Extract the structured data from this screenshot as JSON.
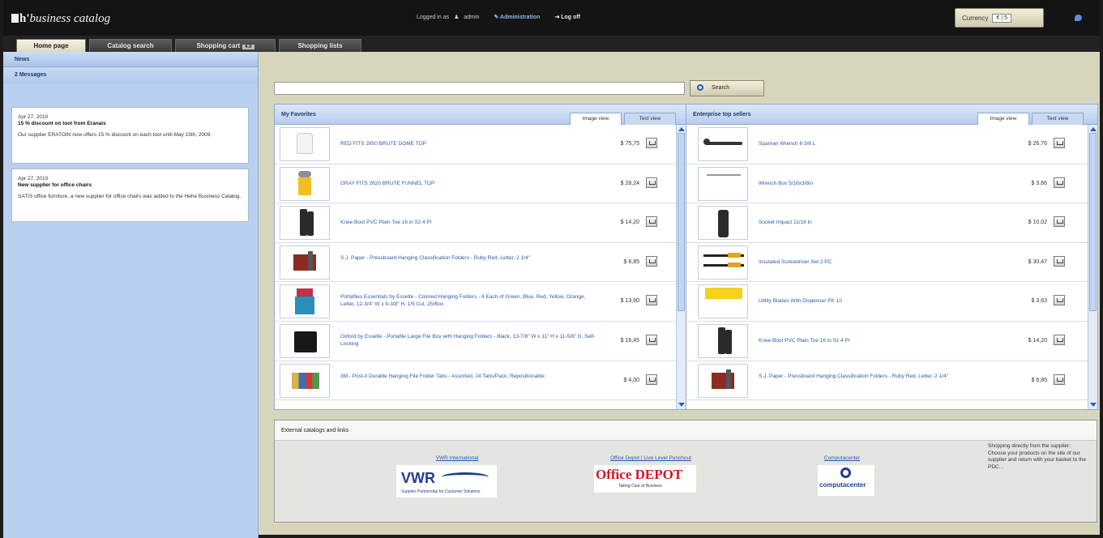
{
  "app": {
    "brand_prefix": "h'",
    "brand_name": "business catalog"
  },
  "userbar": {
    "logged_in_as": "Logged in as",
    "user": "admin",
    "administration": "Administration",
    "log_off": "Log off"
  },
  "currency": {
    "label": "Currency",
    "symbol": "€",
    "value": "5"
  },
  "tabs": [
    {
      "label": "Home page",
      "active": true
    },
    {
      "label": "Catalog search",
      "active": false
    },
    {
      "label": "Shopping cart",
      "badge": "4.0",
      "active": false
    },
    {
      "label": "Shopping lists",
      "active": false
    }
  ],
  "sidebar": {
    "news_heading": "News",
    "messages_count": "2 Messages",
    "news": [
      {
        "date": "Apr 27, 2010",
        "title": "15 % discount on tool from Eranais",
        "body": "Our supplier ERATOIN now offers 15 % discount on each tool until May 15th, 2009."
      },
      {
        "date": "Apr 27, 2010",
        "title": "New supplier for office chairs",
        "body": "SATIS office furniture, a new supplier for office chairs was added to the Hehe Business Catalog."
      }
    ]
  },
  "search": {
    "placeholder": "",
    "button": "Search"
  },
  "favorites": {
    "title": "My Favorites",
    "view_image": "Image view",
    "view_text": "Text view",
    "items": [
      {
        "name": "RED FITS 2850 BRUTE DOME TOP",
        "price": "$ 75,75"
      },
      {
        "name": "GRAY FITS 2620 BRUTE FUNNEL TOP",
        "price": "$ 28,24"
      },
      {
        "name": "Knee Boot PVC Plain Toe 16 in Sz 4 Pr",
        "price": "$ 14,20"
      },
      {
        "name": "S.J. Paper - Pressboard Hanging Classification Folders - Ruby Red, Letter, 2 1/4\"",
        "price": "$ 6,85"
      },
      {
        "name": "Portafiles Essentials by Esselte - Colored Hanging Folders - 6 Each of Green, Blue, Red, Yellow, Orange, Letter, 12-3/4\" W x 9-3/8\" H, 1/5 Cut, 25/Box",
        "price": "$ 13,60"
      },
      {
        "name": "Oxford by Esselte - Portafile Large File Box with Hanging Folders - Black, 13-7/8\" W x 11\" H x 11-5/8\" D, Self-Locking",
        "price": "$ 16,45"
      },
      {
        "name": "3M - Post-it Durable Hanging File Folder Tabs - Assorted, 24 Tabs/Pack, Repositionable",
        "price": "$ 4,00"
      }
    ]
  },
  "top_sellers": {
    "title": "Enterprise top sellers",
    "view_image": "Image view",
    "view_text": "Text view",
    "items": [
      {
        "name": "Spanner Wrench 6 3/8 L",
        "price": "$ 26,76"
      },
      {
        "name": "Wrench Box 5/16x3/8in",
        "price": "$ 3,66"
      },
      {
        "name": "Socket Impact 11/16 in",
        "price": "$ 10,02"
      },
      {
        "name": "Insulated Screwdriver Set 2 PC",
        "price": "$ 30,47"
      },
      {
        "name": "Utility Blades With Dispenser PK 10",
        "price": "$ 3,63"
      },
      {
        "name": "Knee Boot PVC Plain Toe 16 in Sz 4 Pr",
        "price": "$ 14,20"
      },
      {
        "name": "S.J. Paper - Pressboard Hanging Classification Folders - Ruby Red, Letter, 2 1/4\"",
        "price": "$ 6,85"
      }
    ]
  },
  "external": {
    "heading": "External catalogs and links",
    "links": [
      {
        "label": "VWR International",
        "logo_text": "VWR",
        "tagline": "Supplier Partnership for Customer Solutions"
      },
      {
        "label": "Office Depot | Live Level Punchout",
        "logo_text": "Office DEPOT",
        "tagline": "Taking Care of Business"
      },
      {
        "label": "Computacenter",
        "logo_text": "computacenter"
      }
    ],
    "note": "Shopping directly from the supplier: Choose your products on the site of our supplier and return with your basket to the PDC..."
  }
}
